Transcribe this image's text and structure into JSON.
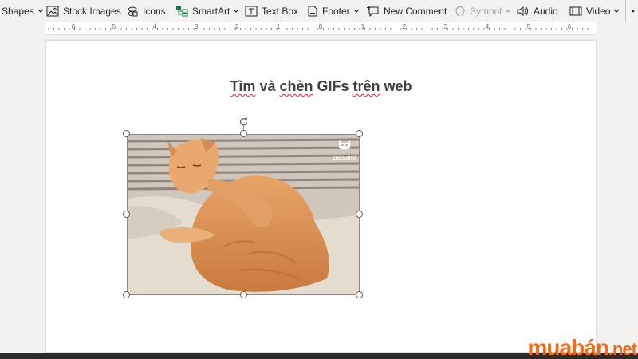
{
  "ribbon": {
    "shapes": "Shapes",
    "stock_images": "Stock Images",
    "icons": "Icons",
    "smartart": "SmartArt",
    "text_box": "Text Box",
    "footer": "Footer",
    "new_comment": "New Comment",
    "symbol": "Symbol",
    "audio": "Audio",
    "video": "Video"
  },
  "ruler": {
    "labels": [
      "6",
      "5",
      "4",
      "3",
      "2",
      "1",
      "0",
      "1",
      "2",
      "3",
      "4",
      "5",
      "6"
    ]
  },
  "document": {
    "title_part1": "Tìm",
    "title_part2": " và ",
    "title_part3": "chèn",
    "title_part4": " GIFs ",
    "title_part5": "trên",
    "title_part6": " web"
  },
  "image": {
    "watermark": "petsami"
  },
  "brand": {
    "main": "muabán",
    "suffix": ".net"
  },
  "colors": {
    "accent": "#f26b1d",
    "text": "#252423",
    "disabled": "#a19f9d",
    "spell_underline": "#e0242a"
  }
}
